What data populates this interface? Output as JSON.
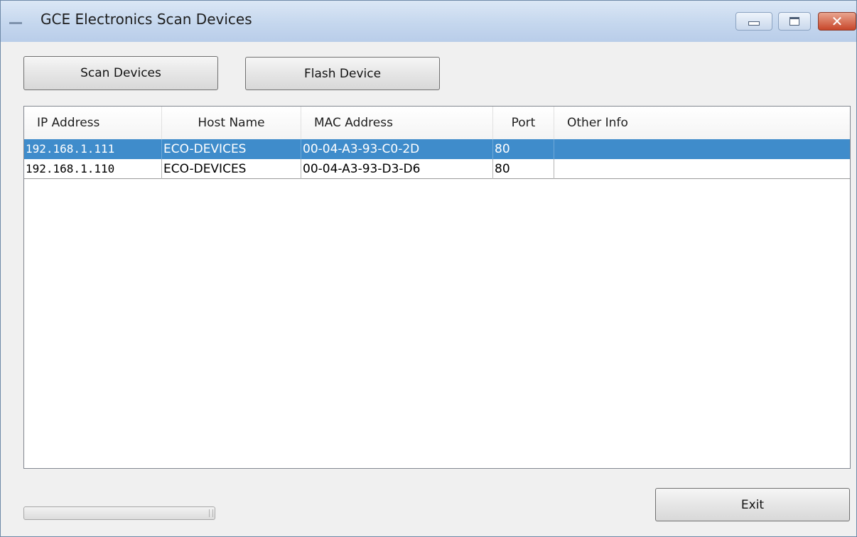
{
  "window": {
    "title": "GCE Electronics Scan Devices",
    "controls": [
      "minimize-icon",
      "maximize-icon",
      "close-icon"
    ]
  },
  "toolbar": {
    "scan_label": "Scan Devices",
    "flash_label": "Flash Device"
  },
  "table": {
    "columns": [
      "IP Address",
      "Host Name",
      "MAC Address",
      "Port",
      "Other Info"
    ],
    "rows": [
      {
        "ip": "192.168.1.111",
        "host": "ECO-DEVICES",
        "mac": "00-04-A3-93-C0-2D",
        "port": "80",
        "other": "",
        "selected": true
      },
      {
        "ip": "192.168.1.110",
        "host": "ECO-DEVICES",
        "mac": "00-04-A3-93-D3-D6",
        "port": "80",
        "other": "",
        "selected": false
      }
    ]
  },
  "footer": {
    "progress": 0,
    "exit_label": "Exit"
  },
  "colors": {
    "selection": "#3f8ccb",
    "titlebar": "#c5d7ee",
    "close_button": "#c8462a"
  }
}
